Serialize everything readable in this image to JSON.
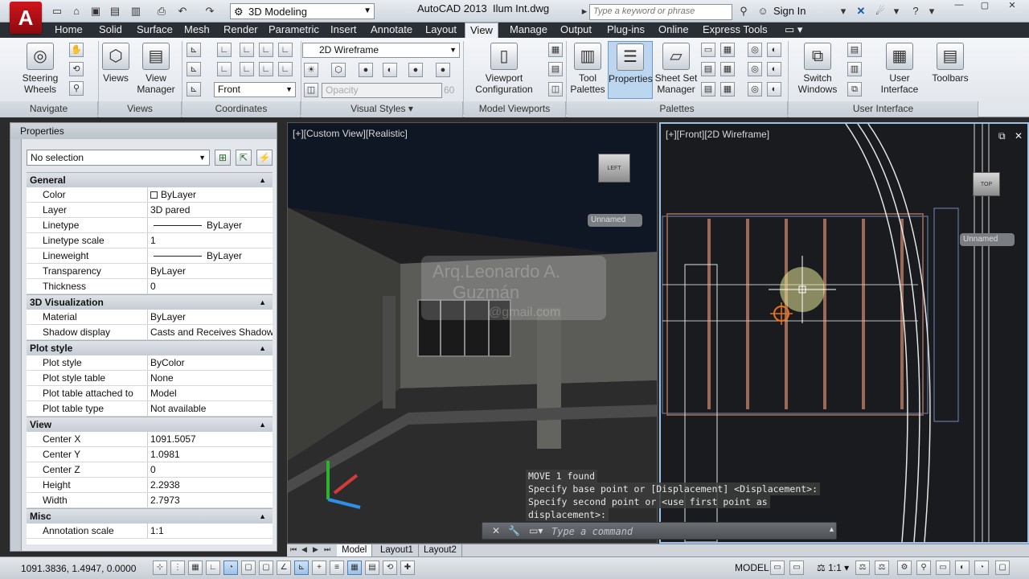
{
  "titlebar": {
    "logo": "A",
    "workspace": "3D Modeling",
    "app_name": "AutoCAD 2013",
    "file_name": "Ilum Int.dwg",
    "search_placeholder": "Type a keyword or phrase",
    "sign_in": "Sign In"
  },
  "ribbon_tabs": [
    "Home",
    "Solid",
    "Surface",
    "Mesh",
    "Render",
    "Parametric",
    "Insert",
    "Annotate",
    "Layout",
    "View",
    "Manage",
    "Output",
    "Plug-ins",
    "Online",
    "Express Tools"
  ],
  "active_tab": "View",
  "ribbon": {
    "navigate": {
      "title": "Navigate",
      "steering": "Steering Wheels"
    },
    "views": {
      "title": "Views",
      "views": "Views",
      "view_manager": "View Manager"
    },
    "coordinates": {
      "title": "Coordinates",
      "ucs_select": "Front"
    },
    "visual_styles": {
      "title": "Visual Styles",
      "style_select": "2D Wireframe",
      "opacity_label": "Opacity",
      "opacity_value": "60"
    },
    "model_viewports": {
      "title": "Model Viewports",
      "viewport_config": "Viewport Configuration"
    },
    "palettes": {
      "title": "Palettes",
      "tool_palettes": "Tool Palettes",
      "properties": "Properties",
      "sheet_set": "Sheet Set Manager"
    },
    "user_interface": {
      "title": "User Interface",
      "switch_windows": "Switch Windows",
      "user_interface": "User Interface",
      "toolbars": "Toolbars"
    }
  },
  "properties": {
    "title": "Properties",
    "selection": "No selection",
    "sections": [
      {
        "name": "General",
        "rows": [
          {
            "key": "Color",
            "value": "ByLayer",
            "type": "swatch"
          },
          {
            "key": "Layer",
            "value": "3D pared"
          },
          {
            "key": "Linetype",
            "value": "ByLayer",
            "type": "line"
          },
          {
            "key": "Linetype scale",
            "value": "1"
          },
          {
            "key": "Lineweight",
            "value": "ByLayer",
            "type": "line"
          },
          {
            "key": "Transparency",
            "value": "ByLayer"
          },
          {
            "key": "Thickness",
            "value": "0"
          }
        ]
      },
      {
        "name": "3D Visualization",
        "rows": [
          {
            "key": "Material",
            "value": "ByLayer"
          },
          {
            "key": "Shadow display",
            "value": "Casts and Receives Shadows"
          }
        ]
      },
      {
        "name": "Plot style",
        "rows": [
          {
            "key": "Plot style",
            "value": "ByColor"
          },
          {
            "key": "Plot style table",
            "value": "None"
          },
          {
            "key": "Plot table attached to",
            "value": "Model"
          },
          {
            "key": "Plot table type",
            "value": "Not available"
          }
        ]
      },
      {
        "name": "View",
        "rows": [
          {
            "key": "Center X",
            "value": "1091.5057"
          },
          {
            "key": "Center Y",
            "value": "1.0981"
          },
          {
            "key": "Center Z",
            "value": "0"
          },
          {
            "key": "Height",
            "value": "2.2938"
          },
          {
            "key": "Width",
            "value": "2.7973"
          }
        ]
      },
      {
        "name": "Misc",
        "rows": [
          {
            "key": "Annotation scale",
            "value": "1:1"
          }
        ]
      }
    ]
  },
  "viewports": {
    "left_label": "[+][Custom View][Realistic]",
    "right_label": "[+][Front][2D Wireframe]",
    "left_cube": "LEFT",
    "right_cube": "TOP",
    "unnamed": "Unnamed",
    "watermark_1": "Arq.Leonardo A.",
    "watermark_2": "Guzmán",
    "watermark_3": "@gmail.com"
  },
  "command": {
    "history": [
      "MOVE 1 found",
      "Specify base point or [Displacement] <Displacement>:",
      "Specify second point or <use first point as",
      "displacement>:"
    ],
    "placeholder": "Type a command"
  },
  "layout_tabs": [
    "Model",
    "Layout1",
    "Layout2"
  ],
  "status": {
    "coords": "1091.3836, 1.4947, 0.0000",
    "model": "MODEL",
    "annotation_scale": "1:1"
  },
  "colors": {
    "ribbon_tab_bg": "#2a2f35",
    "accent": "#9bc1e6",
    "logo_red": "#d0141b"
  }
}
